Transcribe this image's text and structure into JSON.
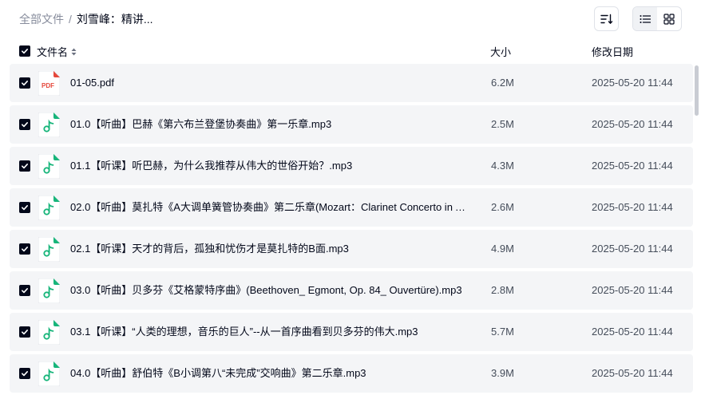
{
  "breadcrumb": {
    "root": "全部文件",
    "separator": "/",
    "current": "刘雪峰：精讲..."
  },
  "toolbar": {
    "sort_icon": "sort-descending-icon",
    "list_view_icon": "list-view-icon",
    "grid_view_icon": "grid-view-icon",
    "active_view": "list"
  },
  "table": {
    "select_all_checked": true,
    "headers": {
      "name": "文件名",
      "size": "大小",
      "modified": "修改日期"
    },
    "rows": [
      {
        "checked": true,
        "icon": "pdf-file-icon",
        "name": "01-05.pdf",
        "size": "6.2M",
        "modified": "2025-05-20 11:44"
      },
      {
        "checked": true,
        "icon": "audio-file-icon",
        "name": "01.0【听曲】巴赫《第六布兰登堡协奏曲》第一乐章.mp3",
        "size": "2.5M",
        "modified": "2025-05-20 11:44"
      },
      {
        "checked": true,
        "icon": "audio-file-icon",
        "name": "01.1【听课】听巴赫，为什么我推荐从伟大的世俗开始？.mp3",
        "size": "4.3M",
        "modified": "2025-05-20 11:44"
      },
      {
        "checked": true,
        "icon": "audio-file-icon",
        "name": "02.0【听曲】莫扎特《A大调单簧管协奏曲》第二乐章(Mozart：Clarinet Concerto in A ...",
        "size": "2.6M",
        "modified": "2025-05-20 11:44"
      },
      {
        "checked": true,
        "icon": "audio-file-icon",
        "name": "02.1【听课】天才的背后，孤独和忧伤才是莫扎特的B面.mp3",
        "size": "4.9M",
        "modified": "2025-05-20 11:44"
      },
      {
        "checked": true,
        "icon": "audio-file-icon",
        "name": "03.0【听曲】贝多芬《艾格蒙特序曲》(Beethoven_ Egmont, Op. 84_ Ouvertüre).mp3",
        "size": "2.8M",
        "modified": "2025-05-20 11:44"
      },
      {
        "checked": true,
        "icon": "audio-file-icon",
        "name": "03.1【听课】“人类的理想，音乐的巨人”--从一首序曲看到贝多芬的伟大.mp3",
        "size": "5.7M",
        "modified": "2025-05-20 11:44"
      },
      {
        "checked": true,
        "icon": "audio-file-icon",
        "name": "04.0【听曲】舒伯特《B小调第八“未完成”交响曲》第二乐章.mp3",
        "size": "3.9M",
        "modified": "2025-05-20 11:44"
      }
    ]
  },
  "colors": {
    "text_primary": "#03081a",
    "text_secondary": "#878c9c",
    "row_background": "#f4f5f7",
    "checkbox": "#03081a",
    "pdf_red": "#e5483b",
    "audio_green": "#17b57a"
  }
}
